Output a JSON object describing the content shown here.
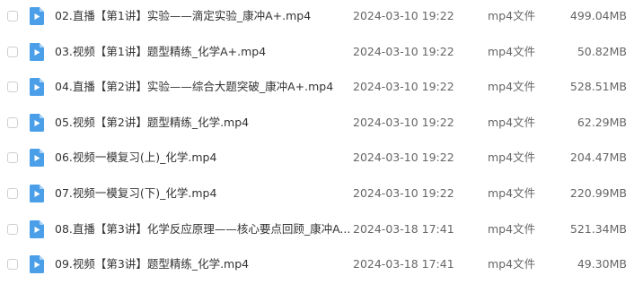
{
  "colors": {
    "file_icon": "#4a9fe8",
    "file_icon_fold": "#a9d1f7",
    "checkbox_border": "#cfcfcf",
    "name_text": "#333333",
    "meta_text": "#666666"
  },
  "files": [
    {
      "icon": "video-file-icon",
      "name": "02.直播【第1讲】实验——滴定实验_康冲A+.mp4",
      "date": "2024-03-10 19:22",
      "type": "mp4文件",
      "size": "499.04MB"
    },
    {
      "icon": "video-file-icon",
      "name": "03.视频【第1讲】题型精练_化学A+.mp4",
      "date": "2024-03-10 19:22",
      "type": "mp4文件",
      "size": "50.82MB"
    },
    {
      "icon": "video-file-icon",
      "name": "04.直播【第2讲】实验——综合大题突破_康冲A+.mp4",
      "date": "2024-03-10 19:22",
      "type": "mp4文件",
      "size": "528.51MB"
    },
    {
      "icon": "video-file-icon",
      "name": "05.视频【第2讲】题型精练_化学.mp4",
      "date": "2024-03-10 19:22",
      "type": "mp4文件",
      "size": "62.29MB"
    },
    {
      "icon": "video-file-icon",
      "name": "06.视频一模复习(上)_化学.mp4",
      "date": "2024-03-10 19:22",
      "type": "mp4文件",
      "size": "204.47MB"
    },
    {
      "icon": "video-file-icon",
      "name": "07.视频一模复习(下)_化学.mp4",
      "date": "2024-03-10 19:22",
      "type": "mp4文件",
      "size": "220.99MB"
    },
    {
      "icon": "video-file-icon",
      "name": "08.直播【第3讲】化学反应原理——核心要点回顾_康冲A...",
      "date": "2024-03-18 17:41",
      "type": "mp4文件",
      "size": "521.34MB"
    },
    {
      "icon": "video-file-icon",
      "name": "09.视频【第3讲】题型精练_化学.mp4",
      "date": "2024-03-18 17:41",
      "type": "mp4文件",
      "size": "49.30MB"
    }
  ]
}
